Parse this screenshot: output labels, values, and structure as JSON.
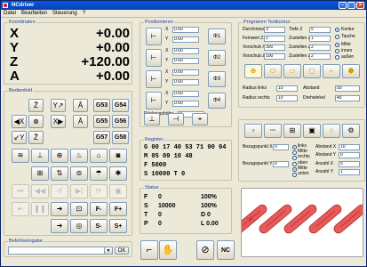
{
  "app": {
    "title": "NCdriver"
  },
  "menu": [
    "Datei",
    "Bearbeiten",
    "Steuerung",
    "?"
  ],
  "koordinaten": {
    "title": "Koordinaten",
    "axes": [
      {
        "label": "X",
        "value": "+0.00"
      },
      {
        "label": "Y",
        "value": "+0.00"
      },
      {
        "label": "Z",
        "value": "+120.00"
      },
      {
        "label": "A",
        "value": "+0.00"
      }
    ]
  },
  "bedienfeld": {
    "title": "Bedienfeld",
    "gbuttons": [
      "G53",
      "G54",
      "G55",
      "G56",
      "G57",
      "G58"
    ],
    "feed_minus": "F-",
    "feed_plus": "F+",
    "spindle_minus": "S-",
    "spindle_plus": "S+"
  },
  "befehlseingabe": {
    "title": "Befehlseingabe",
    "ok": "OK",
    "value": ""
  },
  "positionieren": {
    "title": "Positionieren",
    "rows": [
      {
        "axis": "X",
        "value": "0.00"
      },
      {
        "axis": "Y",
        "value": "0.00"
      },
      {
        "axis": "X",
        "value": "0.00"
      },
      {
        "axis": "Y",
        "value": "0.00"
      },
      {
        "axis": "X",
        "value": "0.00"
      },
      {
        "axis": "Y",
        "value": "0.00"
      },
      {
        "axis": "X",
        "value": "0.00"
      },
      {
        "axis": "Y",
        "value": "0.00"
      }
    ],
    "phi_labels": [
      "Φ1",
      "Φ2",
      "Φ3",
      "Φ4"
    ],
    "rueckzug_label": "Rückzugshöhe",
    "rueckzug_value": "0"
  },
  "register": {
    "title": "Register",
    "lines": [
      "G  00 17 40 53 71 90 94",
      "M  05 09 10 48",
      "F  5000",
      "S  10000    T  0"
    ]
  },
  "status": {
    "title": "Status",
    "lines": [
      [
        "F",
        "0",
        "100%"
      ],
      [
        "S",
        "10000",
        "100%"
      ],
      [
        "T",
        "0",
        "D  0"
      ],
      [
        "P",
        "0",
        "L  0.00"
      ]
    ]
  },
  "programm": {
    "title": "Programm Testkontur",
    "fields": [
      {
        "label": "Durchmesser",
        "value": "3"
      },
      {
        "label": "Tiefe Z",
        "value": "5"
      },
      {
        "label": "Feinwert Z",
        "value": "2"
      },
      {
        "label": "Zustellen Z",
        "value": "1"
      },
      {
        "label": "Vorschub XY",
        "value": "300"
      },
      {
        "label": "Zustellen Z",
        "value": "2"
      },
      {
        "label": "Vorschub Z",
        "value": "100"
      },
      {
        "label": "Zustellen Z",
        "value": "2"
      }
    ],
    "radio_opts_1": [
      "Kontur",
      "Tasche"
    ],
    "radio_opts_2": [
      "Mitte",
      "innen",
      "außen"
    ],
    "radius_links_label": "Radius links",
    "radius_links_value": "10",
    "abstand_label": "Abstand",
    "abstand_value": "50",
    "radius_rechts_label": "Radius rechts",
    "radius_rechts_value": "10",
    "drehwinkel_label": "Drehwinkel",
    "drehwinkel_value": "45",
    "bezugspunkt_x_label": "Bezugspunkt X",
    "bezugspunkt_x_value": "0",
    "bezugspunkt_y_label": "Bezugspunkt Y",
    "bezugspunkt_y_value": "0",
    "x_opts": [
      "links",
      "Mitte",
      "rechts"
    ],
    "y_opts": [
      "oben",
      "Mitte",
      "unten"
    ],
    "abstand_x_label": "Abstand X",
    "abstand_x_value": "10",
    "abstand_y_label": "Abstand Y",
    "abstand_y_value": "0",
    "anzahl_x_label": "Anzahl X",
    "anzahl_x_value": "5",
    "anzahl_y_label": "Anzahl Y",
    "anzahl_y_value": "1"
  },
  "bottom": {
    "nc_label": "NC"
  },
  "colors": {
    "accent": "#1d40a8",
    "shape": "#e85a5a",
    "shape_stroke": "#a02020",
    "tool_yellow": "#f0c020"
  }
}
